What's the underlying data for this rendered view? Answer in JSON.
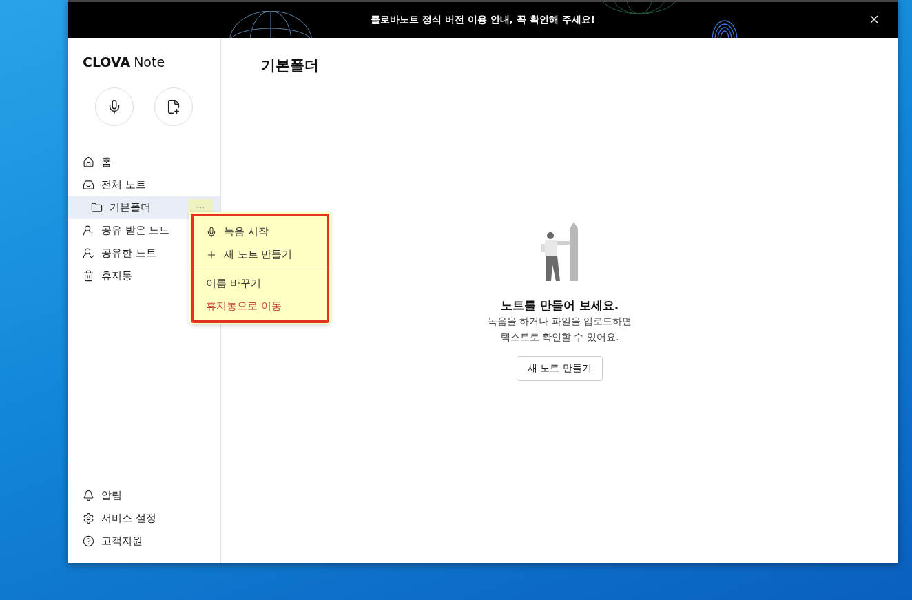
{
  "banner": {
    "text": "클로바노트 정식 버전 이용 안내, 꼭 확인해 주세요!"
  },
  "sidebar": {
    "logo_bold": "CLOVA",
    "logo_light": "Note",
    "actions": [
      {
        "kind": "mic"
      },
      {
        "kind": "note-add"
      }
    ],
    "nav": [
      {
        "kind": "home",
        "label": "홈",
        "selected": false
      },
      {
        "kind": "inbox",
        "label": "전체 노트",
        "selected": false,
        "children": [
          {
            "kind": "folder",
            "label": "기본폴더",
            "selected": true,
            "more": "···"
          }
        ]
      },
      {
        "kind": "user-in",
        "label": "공유 받은 노트",
        "selected": false
      },
      {
        "kind": "user-out",
        "label": "공유한 노트",
        "selected": false
      },
      {
        "kind": "trash",
        "label": "휴지통",
        "selected": false
      }
    ],
    "footer": [
      {
        "kind": "bell",
        "label": "알림"
      },
      {
        "kind": "gear",
        "label": "서비스 설정"
      },
      {
        "kind": "help",
        "label": "고객지원"
      }
    ]
  },
  "context_menu": {
    "groups": [
      [
        {
          "kind": "mic",
          "label": "녹음 시작",
          "danger": false
        },
        {
          "kind": "plus",
          "label": "새 노트 만들기",
          "danger": false
        }
      ],
      [
        {
          "kind": "text",
          "label": "이름 바꾸기",
          "danger": false
        },
        {
          "kind": "text",
          "label": "휴지통으로 이동",
          "danger": true
        }
      ]
    ]
  },
  "main": {
    "title": "기본폴더",
    "empty": {
      "heading": "노트를 만들어 보세요.",
      "lines": [
        "녹음을 하거나 파일을 업로드하면",
        "텍스트로 확인할 수 있어요."
      ],
      "button": "새 노트 만들기"
    }
  }
}
